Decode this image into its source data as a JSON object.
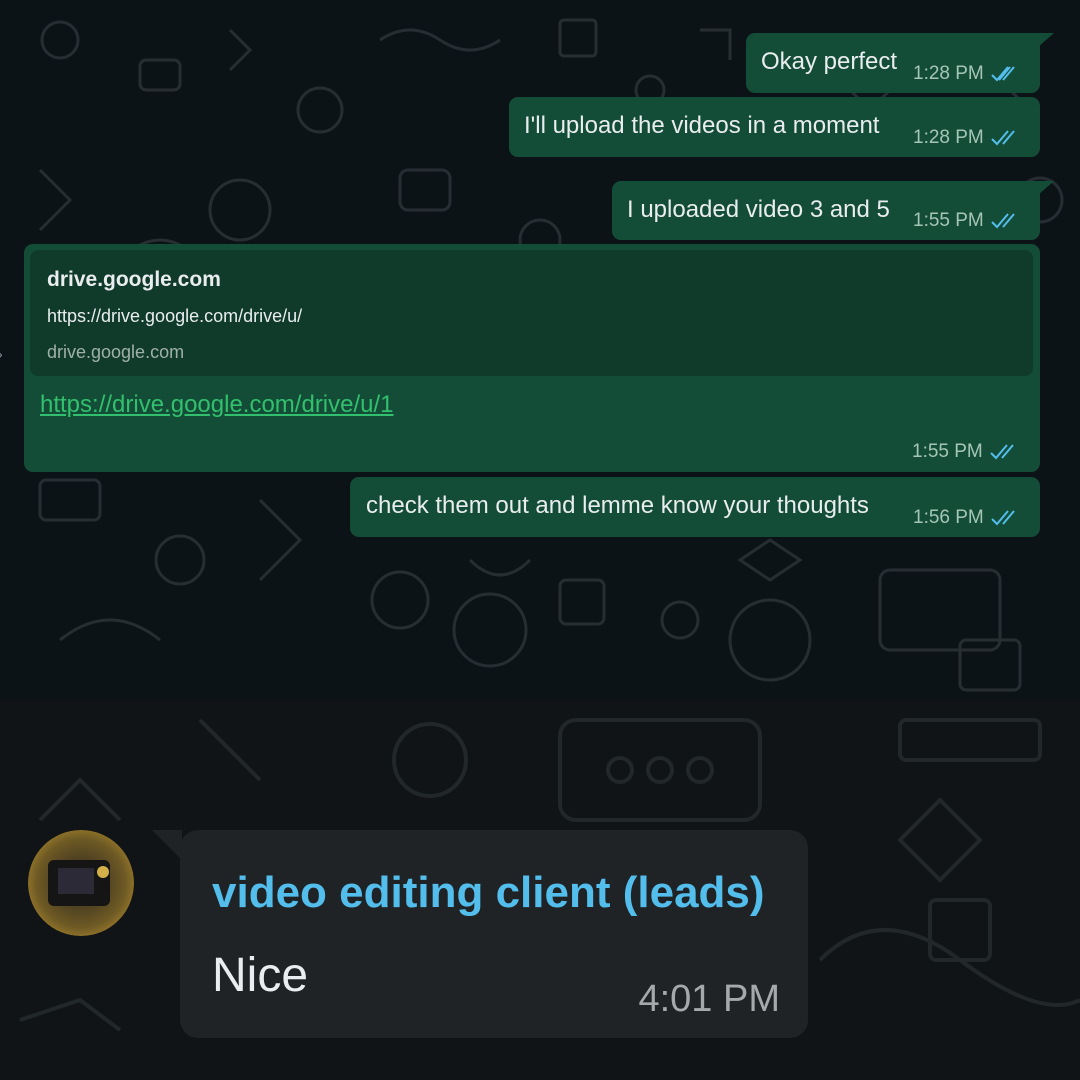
{
  "messages": [
    {
      "text": "Okay perfect",
      "time": "1:28 PM"
    },
    {
      "text": "I'll upload the videos in a moment",
      "time": "1:28 PM"
    },
    {
      "text": "I uploaded video 3 and 5",
      "time": "1:55 PM"
    },
    {
      "link_preview": {
        "title": "drive.google.com",
        "url": "https://drive.google.com/drive/u/",
        "domain": "drive.google.com"
      },
      "text": "https://drive.google.com/drive/u/1",
      "time": "1:55 PM"
    },
    {
      "text": "check them out and lemme know your thoughts",
      "time": "1:56 PM"
    }
  ],
  "incoming": {
    "sender": "video editing client (leads)",
    "text": "Nice",
    "time": "4:01 PM"
  },
  "colors": {
    "outgoing_bubble": "#144d37",
    "incoming_bubble": "#1f2326",
    "sender_name": "#53bdeb",
    "read_ticks": "#53bdeb",
    "link": "#32c06e"
  },
  "icons": {
    "read_receipt": "double-check-icon",
    "avatar": "contact-avatar"
  }
}
